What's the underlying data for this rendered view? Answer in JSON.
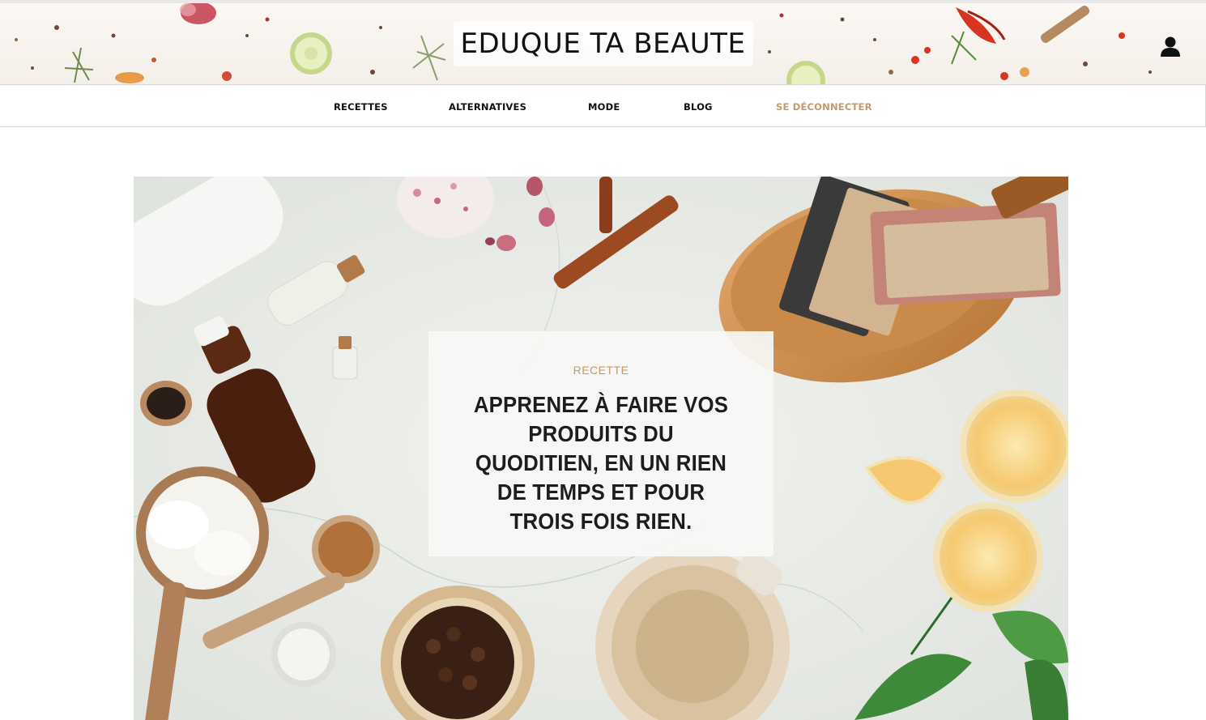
{
  "site": {
    "title": "EDUQUE TA BEAUTE"
  },
  "header": {
    "user_icon": "user-icon"
  },
  "nav": {
    "items": [
      {
        "label": "RECETTES"
      },
      {
        "label": "ALTERNATIVES"
      },
      {
        "label": "MODE"
      },
      {
        "label": "BLOG"
      },
      {
        "label": "SE DÉCONNECTER"
      }
    ],
    "accent_color": "#c29a6b"
  },
  "hero": {
    "category": "RECETTE",
    "headline": "APPRENEZ À FAIRE VOS PRODUITS DU QUODITIEN, EN UN RIEN DE TEMPS ET POUR TROIS FOIS RIEN."
  }
}
